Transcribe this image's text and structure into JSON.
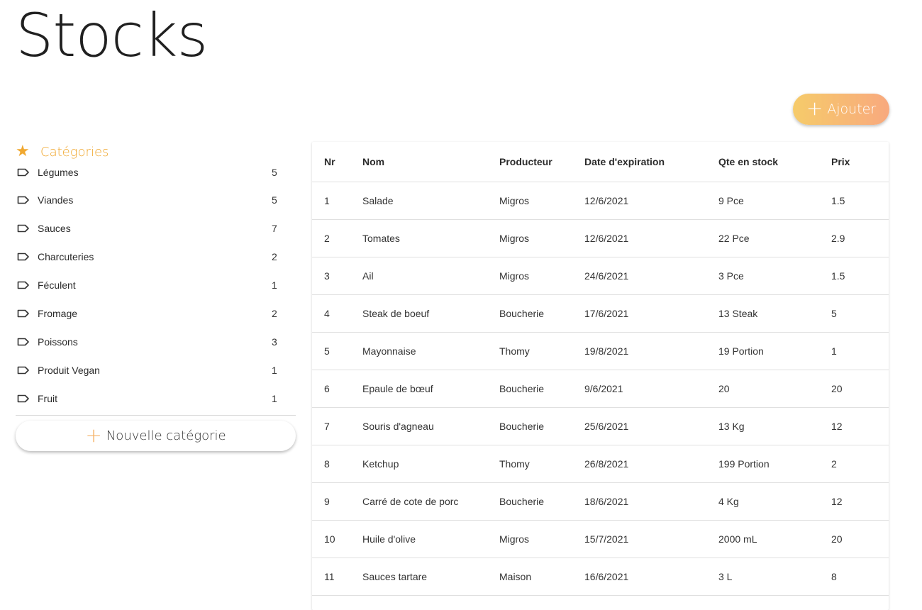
{
  "page": {
    "title": "Stocks"
  },
  "toolbar": {
    "add_icon": "+",
    "add_label": "Ajouter"
  },
  "sidebar": {
    "header_icon": "star-icon",
    "header_label": "Catégories",
    "items": [
      {
        "label": "Légumes",
        "count": "5"
      },
      {
        "label": "Viandes",
        "count": "5"
      },
      {
        "label": "Sauces",
        "count": "7"
      },
      {
        "label": "Charcuteries",
        "count": "2"
      },
      {
        "label": "Féculent",
        "count": "1"
      },
      {
        "label": "Fromage",
        "count": "2"
      },
      {
        "label": "Poissons",
        "count": "3"
      },
      {
        "label": "Produit Vegan",
        "count": "1"
      },
      {
        "label": "Fruit",
        "count": "1"
      }
    ],
    "new_category_icon": "+",
    "new_category_label": "Nouvelle catégorie"
  },
  "table": {
    "columns": [
      "Nr",
      "Nom",
      "Producteur",
      "Date d'expiration",
      "Qte en stock",
      "Prix"
    ],
    "rows": [
      [
        "1",
        "Salade",
        "Migros",
        "12/6/2021",
        "9 Pce",
        "1.5"
      ],
      [
        "2",
        "Tomates",
        "Migros",
        "12/6/2021",
        "22 Pce",
        "2.9"
      ],
      [
        "3",
        "Ail",
        "Migros",
        "24/6/2021",
        "3 Pce",
        "1.5"
      ],
      [
        "4",
        "Steak de boeuf",
        "Boucherie",
        "17/6/2021",
        "13 Steak",
        "5"
      ],
      [
        "5",
        "Mayonnaise",
        "Thomy",
        "19/8/2021",
        "19 Portion",
        "1"
      ],
      [
        "6",
        "Epaule de bœuf",
        "Boucherie",
        "9/6/2021",
        "20",
        "20"
      ],
      [
        "7",
        "Souris d'agneau",
        "Boucherie",
        "25/6/2021",
        "13 Kg",
        "12"
      ],
      [
        "8",
        "Ketchup",
        "Thomy",
        "26/8/2021",
        "199 Portion",
        "2"
      ],
      [
        "9",
        "Carré de cote de porc",
        "Boucherie",
        "18/6/2021",
        "4 Kg",
        "12"
      ],
      [
        "10",
        "Huile d'olive",
        "Migros",
        "15/7/2021",
        "2000 mL",
        "20"
      ],
      [
        "11",
        "Sauces tartare",
        "Maison",
        "16/6/2021",
        "3 L",
        "8"
      ]
    ]
  },
  "colors": {
    "accent": "#f0a830",
    "button_gradient_start": "#f6cb6a",
    "button_gradient_end": "#f8a97e"
  }
}
